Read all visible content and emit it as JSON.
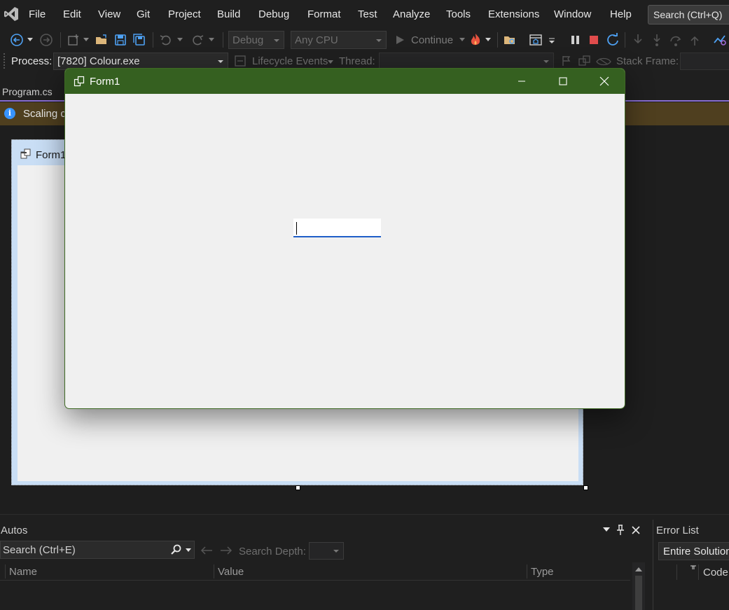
{
  "menu": [
    "File",
    "Edit",
    "View",
    "Git",
    "Project",
    "Build",
    "Debug",
    "Format",
    "Test",
    "Analyze",
    "Tools",
    "Extensions",
    "Window",
    "Help"
  ],
  "search": {
    "label": "Search (Ctrl+Q)"
  },
  "toolbar": {
    "configuration": "Debug",
    "platform": "Any CPU",
    "continue_label": "Continue"
  },
  "process_bar": {
    "process_label": "Process:",
    "process_value": "[7820] Colour.exe",
    "lifecycle_label": "Lifecycle Events",
    "thread_label": "Thread:",
    "stack_frame_label": "Stack Frame:"
  },
  "doc_tab": {
    "label": "Program.cs"
  },
  "infobar": {
    "text": "Scaling c"
  },
  "designer": {
    "form_title": "Form1"
  },
  "runtime_window": {
    "title": "Form1",
    "textbox_value": ""
  },
  "autos": {
    "title": "Autos",
    "search_placeholder": "Search (Ctrl+E)",
    "search_depth_label": "Search Depth:",
    "columns": [
      "Name",
      "Value",
      "Type"
    ]
  },
  "error_list": {
    "title": "Error List",
    "scope": "Entire Solution",
    "code_col": "Code"
  },
  "colors": {
    "accent": "#8a6ed1",
    "titlebar": "#356020",
    "infobar": "#4f3f1f"
  }
}
